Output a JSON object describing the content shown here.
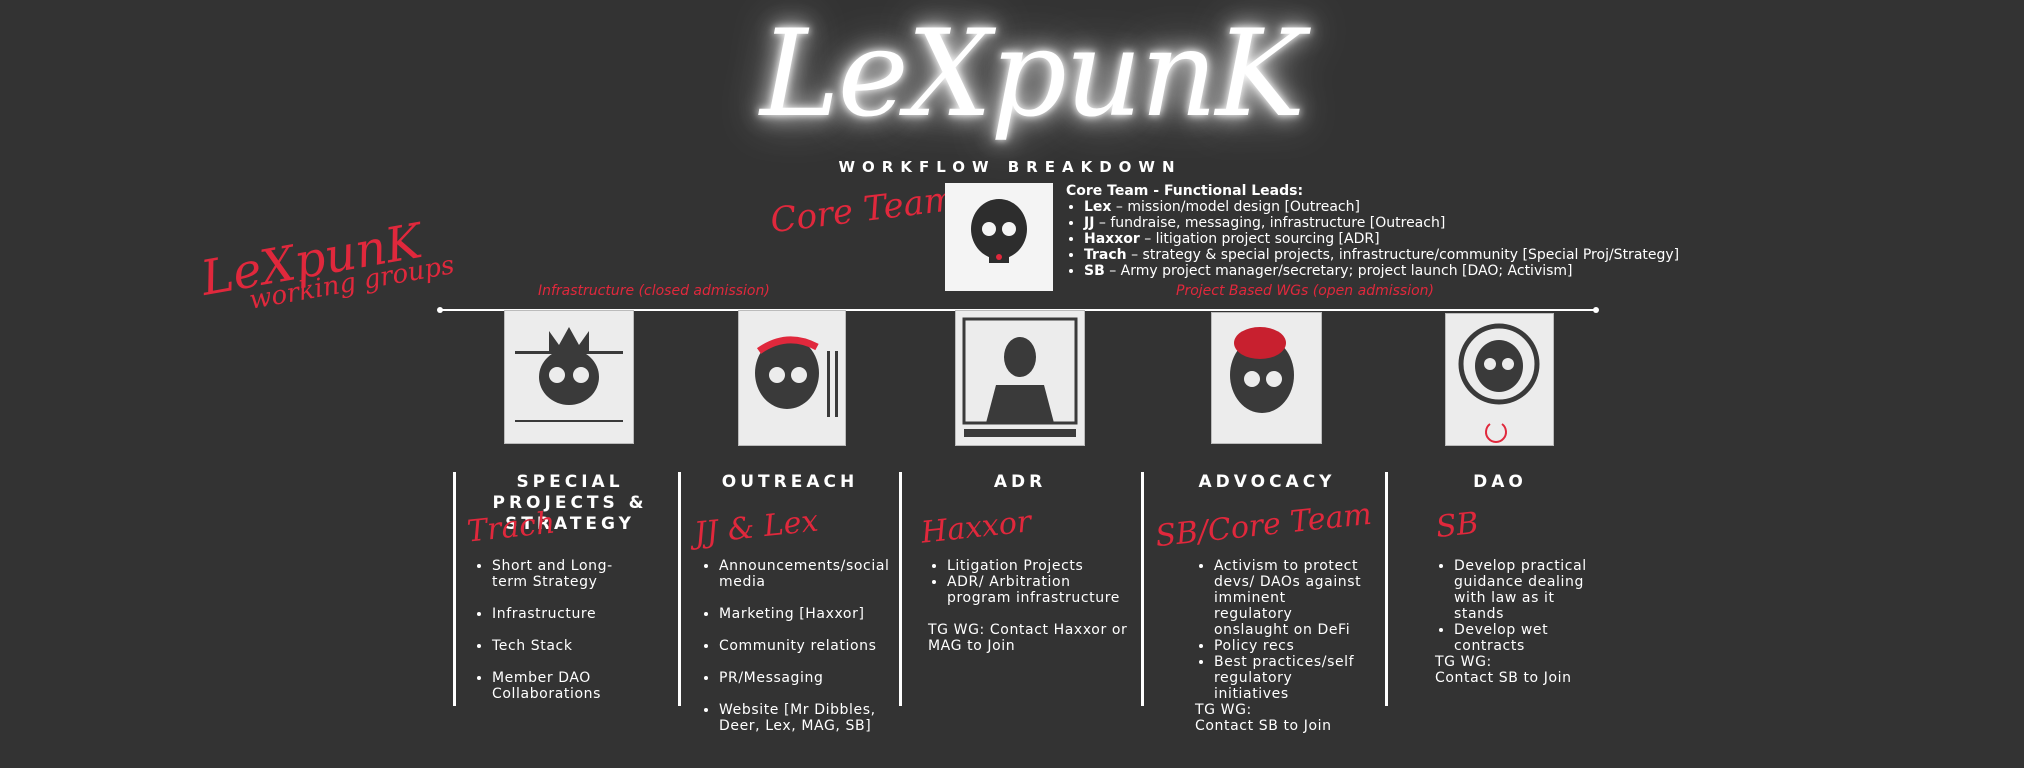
{
  "logo": "LeXpunK",
  "subtitle": "WORKFLOW BREAKDOWN",
  "core_team_script": "Core Team",
  "working_groups_script_1": "LeXpunK",
  "working_groups_script_2": "working groups",
  "core_badge_caption": "LeXpunK Core Team",
  "core_box": {
    "heading": "Core Team - Functional Leads:",
    "leads": [
      {
        "name": "Lex",
        "desc": " – mission/model design [Outreach]"
      },
      {
        "name": "JJ",
        "desc": " – fundraise, messaging, infrastructure [Outreach]"
      },
      {
        "name": "Haxxor",
        "desc": " – litigation project sourcing [ADR]"
      },
      {
        "name": "Trach",
        "desc": " – strategy & special projects, infrastructure/community [Special Proj/Strategy]"
      },
      {
        "name": "SB",
        "desc": " – Army project manager/secretary; project launch [DAO; Activism]"
      }
    ]
  },
  "admission": {
    "left": "Infrastructure (closed admission)",
    "right": "Project Based WGs (open admission)"
  },
  "team_images": [
    {
      "caption": "LeXpunK Special Projects & Strategy"
    },
    {
      "caption": "LeXpunK Outreach Team"
    },
    {
      "caption": "LeXpunK ADR Team"
    },
    {
      "caption": "LeXpunK Advocacy Team"
    },
    {
      "caption": "LeXpunK DAO Team"
    }
  ],
  "columns": [
    {
      "title": "SPECIAL PROJECTS & STRATEGY",
      "lead": "Trach",
      "items": [
        "Short and Long-term Strategy",
        "Infrastructure",
        "Tech Stack",
        "Member DAO Collaborations"
      ],
      "note": ""
    },
    {
      "title": "OUTREACH",
      "lead": "JJ & Lex",
      "items": [
        "Announcements/social media",
        "Marketing [Haxxor]",
        "Community relations",
        "PR/Messaging",
        "Website [Mr Dibbles, Deer, Lex, MAG, SB]"
      ],
      "note": ""
    },
    {
      "title": "ADR",
      "lead": "Haxxor",
      "items": [
        "Litigation Projects",
        "ADR/ Arbitration program infrastructure"
      ],
      "note": "TG WG: Contact Haxxor or MAG to Join"
    },
    {
      "title": "ADVOCACY",
      "lead": "SB/Core Team",
      "items": [
        "Activism to protect devs/ DAOs against imminent regulatory onslaught on DeFi",
        "Policy recs",
        "Best practices/self regulatory initiatives"
      ],
      "note_1": "TG WG:",
      "note_2": "Contact SB to Join"
    },
    {
      "title": "DAO",
      "lead": "SB",
      "items": [
        "Develop practical guidance dealing with law as it stands",
        "Develop wet contracts"
      ],
      "note_1": "TG WG:",
      "note_2": "Contact SB to Join"
    }
  ],
  "colors": {
    "background": "#333333",
    "accent": "#e0283c",
    "text": "#ffffff"
  }
}
